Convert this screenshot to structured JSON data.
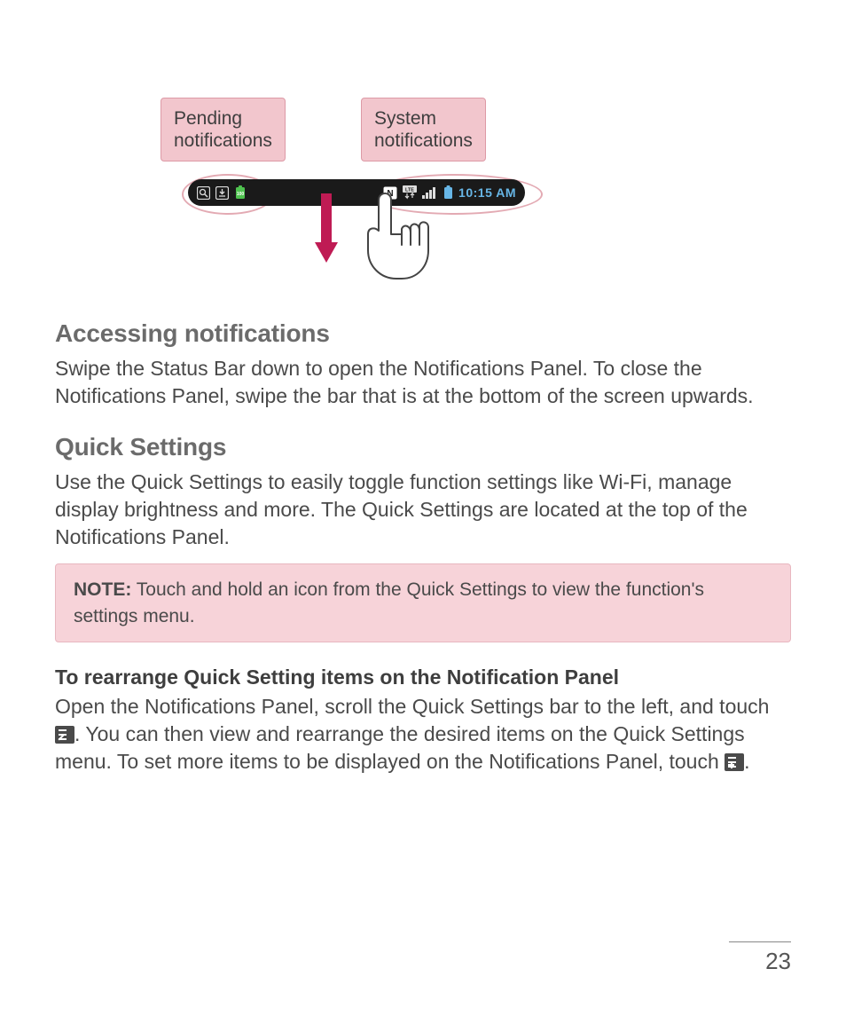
{
  "diagram": {
    "callout_left": "Pending\nnotifications",
    "callout_right": "System\nnotifications",
    "status_time": "10:15 AM",
    "icons_left": [
      "search-icon",
      "download-icon",
      "battery-100-icon"
    ],
    "icons_right": [
      "nfc-icon",
      "lte-data-icon",
      "signal-bars-icon",
      "battery-icon"
    ]
  },
  "sections": {
    "accessing": {
      "title": "Accessing notifications",
      "body": "Swipe the Status Bar down to open the Notifications Panel. To close the Notifications Panel, swipe the bar that is at the bottom of the screen upwards."
    },
    "quick": {
      "title": "Quick Settings",
      "body": "Use the Quick Settings to easily toggle function settings like Wi-Fi, manage display brightness and more. The Quick Settings are located at the top of the Notifications Panel."
    },
    "note": {
      "label": "NOTE:",
      "text": " Touch and hold an icon from the Quick Settings to view the function's settings menu."
    },
    "rearrange": {
      "title": "To rearrange Quick Setting items on the Notification Panel",
      "body_1": "Open the Notifications Panel, scroll the Quick Settings bar to the left, and touch ",
      "body_2": ". You can then view and rearrange the desired items on the Quick Settings menu. To set more items to be displayed on the Notifications Panel, touch ",
      "body_3": "."
    }
  },
  "page_number": "23"
}
